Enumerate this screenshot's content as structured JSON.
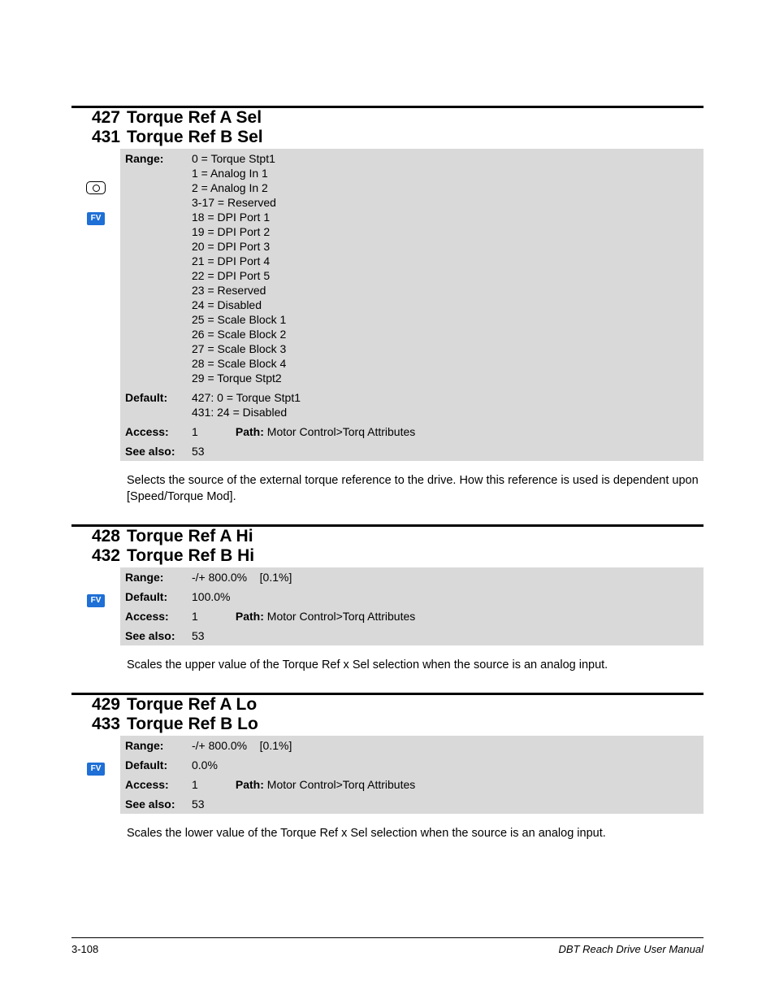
{
  "params": [
    {
      "nums": [
        "427",
        "431"
      ],
      "titles": [
        "Torque Ref A Sel",
        "Torque Ref B Sel"
      ],
      "range_lines": [
        "0 = Torque Stpt1",
        "1 = Analog In 1",
        "2 = Analog In 2",
        "3-17 = Reserved",
        "18 = DPI Port 1",
        "19 = DPI Port 2",
        "20 = DPI Port 3",
        "21 = DPI Port 4",
        "22 = DPI Port 5",
        "23 = Reserved",
        "24 = Disabled",
        "25 = Scale Block 1",
        "26 = Scale Block 2",
        "27 = Scale Block 3",
        "28 = Scale Block 4",
        "29 = Torque Stpt2"
      ],
      "default_lines": [
        "427: 0 = Torque Stpt1",
        "431: 24 = Disabled"
      ],
      "access": "1",
      "path_label": "Path:",
      "path": " Motor Control>Torq Attributes",
      "seealso": "53",
      "show_oval": true,
      "desc": "Selects the source of the external torque reference to the drive. How this reference is used is dependent upon [Speed/Torque Mod]."
    },
    {
      "nums": [
        "428",
        "432"
      ],
      "titles": [
        "Torque Ref A Hi",
        "Torque Ref B Hi"
      ],
      "range_single": "-/+ 800.0%    [0.1%]",
      "default_single": "100.0%",
      "access": "1",
      "path_label": "Path:",
      "path": " Motor Control>Torq Attributes",
      "seealso": "53",
      "show_oval": false,
      "desc": "Scales the upper value of the Torque Ref x Sel selection when the source is an analog input."
    },
    {
      "nums": [
        "429",
        "433"
      ],
      "titles": [
        "Torque Ref A Lo",
        "Torque Ref B Lo"
      ],
      "range_single": "-/+ 800.0%    [0.1%]",
      "default_single": "0.0%",
      "access": "1",
      "path_label": "Path:",
      "path": " Motor Control>Torq Attributes",
      "seealso": "53",
      "show_oval": false,
      "desc": "Scales the lower value of the Torque Ref x Sel selection when the source is an analog input."
    }
  ],
  "labels": {
    "range": "Range:",
    "default": "Default:",
    "access": "Access:",
    "seealso": "See also:"
  },
  "fv": "FV",
  "footer": {
    "left": "3-108",
    "right": "DBT Reach Drive User Manual"
  }
}
